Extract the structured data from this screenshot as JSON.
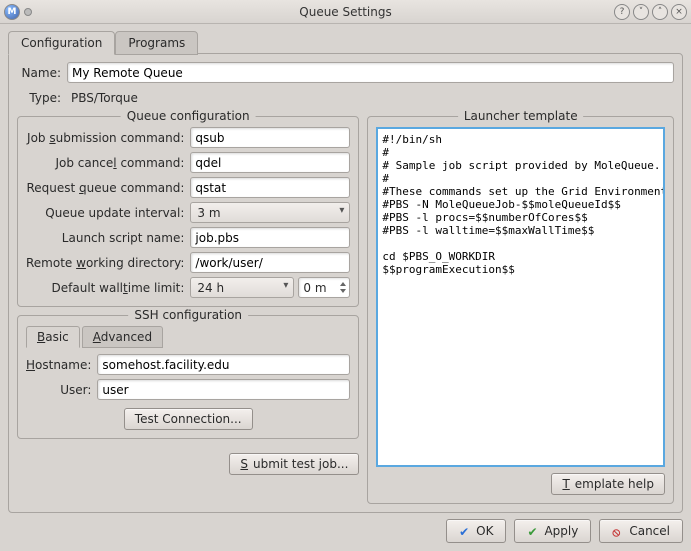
{
  "titlebar": {
    "title": "Queue Settings"
  },
  "tabs": {
    "configuration": "Configuration",
    "programs": "Programs"
  },
  "top": {
    "name_label": "Name:",
    "name_value": "My Remote Queue",
    "type_label": "Type:",
    "type_value": "PBS/Torque"
  },
  "queuecfg": {
    "title": "Queue configuration",
    "job_submission_label": "Job submission command:",
    "job_submission_value": "qsub",
    "job_cancel_label": "Job cancel command:",
    "job_cancel_value": "qdel",
    "request_queue_label": "Request queue command:",
    "request_queue_value": "qstat",
    "update_interval_label": "Queue update interval:",
    "update_interval_value": "3 m",
    "launch_script_label": "Launch script name:",
    "launch_script_value": "job.pbs",
    "remote_dir_label": "Remote working directory:",
    "remote_dir_value": "/work/user/",
    "walltime_label": "Default walltime limit:",
    "walltime_h": "24 h",
    "walltime_m": "0 m"
  },
  "ssh": {
    "title": "SSH configuration",
    "tab_basic": "Basic",
    "tab_advanced": "Advanced",
    "hostname_label": "Hostname:",
    "hostname_value": "somehost.facility.edu",
    "user_label": "User:",
    "user_value": "user",
    "test_btn": "Test Connection..."
  },
  "submit_test_btn": "Submit test job...",
  "launcher": {
    "title": "Launcher template",
    "text": "#!/bin/sh\n#\n# Sample job script provided by MoleQueue.\n#\n#These commands set up the Grid Environment for your job:\n#PBS -N MoleQueueJob-$$moleQueueId$$\n#PBS -l procs=$$numberOfCores$$\n#PBS -l walltime=$$maxWallTime$$\n\ncd $PBS_O_WORKDIR\n$$programExecution$$\n",
    "help_btn": "Template help"
  },
  "buttons": {
    "ok": "OK",
    "apply": "Apply",
    "cancel": "Cancel"
  }
}
